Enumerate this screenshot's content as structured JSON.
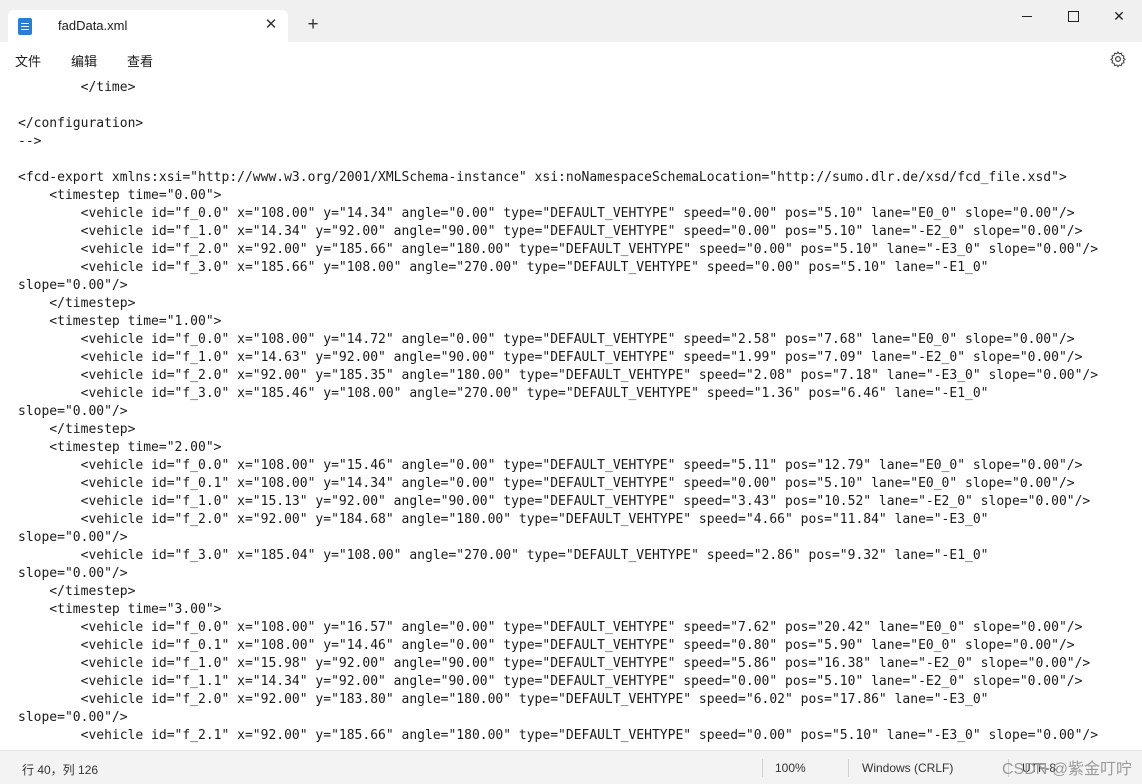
{
  "window": {
    "tab_title": "fadData.xml",
    "tab_close": "✕",
    "new_tab": "+",
    "minimize_label": "",
    "close_glyph": "✕"
  },
  "menu": {
    "items": [
      "文件",
      "编辑",
      "查看"
    ],
    "settings_icon": "gear-icon"
  },
  "editor": {
    "lines": [
      "        </time>",
      "",
      "</configuration>",
      "-->",
      "",
      "<fcd-export xmlns:xsi=\"http://www.w3.org/2001/XMLSchema-instance\" xsi:noNamespaceSchemaLocation=\"http://sumo.dlr.de/xsd/fcd_file.xsd\">",
      "    <timestep time=\"0.00\">",
      "        <vehicle id=\"f_0.0\" x=\"108.00\" y=\"14.34\" angle=\"0.00\" type=\"DEFAULT_VEHTYPE\" speed=\"0.00\" pos=\"5.10\" lane=\"E0_0\" slope=\"0.00\"/>",
      "        <vehicle id=\"f_1.0\" x=\"14.34\" y=\"92.00\" angle=\"90.00\" type=\"DEFAULT_VEHTYPE\" speed=\"0.00\" pos=\"5.10\" lane=\"-E2_0\" slope=\"0.00\"/>",
      "        <vehicle id=\"f_2.0\" x=\"92.00\" y=\"185.66\" angle=\"180.00\" type=\"DEFAULT_VEHTYPE\" speed=\"0.00\" pos=\"5.10\" lane=\"-E3_0\" slope=\"0.00\"/>",
      "        <vehicle id=\"f_3.0\" x=\"185.66\" y=\"108.00\" angle=\"270.00\" type=\"DEFAULT_VEHTYPE\" speed=\"0.00\" pos=\"5.10\" lane=\"-E1_0\"",
      "slope=\"0.00\"/>",
      "    </timestep>",
      "    <timestep time=\"1.00\">",
      "        <vehicle id=\"f_0.0\" x=\"108.00\" y=\"14.72\" angle=\"0.00\" type=\"DEFAULT_VEHTYPE\" speed=\"2.58\" pos=\"7.68\" lane=\"E0_0\" slope=\"0.00\"/>",
      "        <vehicle id=\"f_1.0\" x=\"14.63\" y=\"92.00\" angle=\"90.00\" type=\"DEFAULT_VEHTYPE\" speed=\"1.99\" pos=\"7.09\" lane=\"-E2_0\" slope=\"0.00\"/>",
      "        <vehicle id=\"f_2.0\" x=\"92.00\" y=\"185.35\" angle=\"180.00\" type=\"DEFAULT_VEHTYPE\" speed=\"2.08\" pos=\"7.18\" lane=\"-E3_0\" slope=\"0.00\"/>",
      "        <vehicle id=\"f_3.0\" x=\"185.46\" y=\"108.00\" angle=\"270.00\" type=\"DEFAULT_VEHTYPE\" speed=\"1.36\" pos=\"6.46\" lane=\"-E1_0\"",
      "slope=\"0.00\"/>",
      "    </timestep>",
      "    <timestep time=\"2.00\">",
      "        <vehicle id=\"f_0.0\" x=\"108.00\" y=\"15.46\" angle=\"0.00\" type=\"DEFAULT_VEHTYPE\" speed=\"5.11\" pos=\"12.79\" lane=\"E0_0\" slope=\"0.00\"/>",
      "        <vehicle id=\"f_0.1\" x=\"108.00\" y=\"14.34\" angle=\"0.00\" type=\"DEFAULT_VEHTYPE\" speed=\"0.00\" pos=\"5.10\" lane=\"E0_0\" slope=\"0.00\"/>",
      "        <vehicle id=\"f_1.0\" x=\"15.13\" y=\"92.00\" angle=\"90.00\" type=\"DEFAULT_VEHTYPE\" speed=\"3.43\" pos=\"10.52\" lane=\"-E2_0\" slope=\"0.00\"/>",
      "        <vehicle id=\"f_2.0\" x=\"92.00\" y=\"184.68\" angle=\"180.00\" type=\"DEFAULT_VEHTYPE\" speed=\"4.66\" pos=\"11.84\" lane=\"-E3_0\"",
      "slope=\"0.00\"/>",
      "        <vehicle id=\"f_3.0\" x=\"185.04\" y=\"108.00\" angle=\"270.00\" type=\"DEFAULT_VEHTYPE\" speed=\"2.86\" pos=\"9.32\" lane=\"-E1_0\"",
      "slope=\"0.00\"/>",
      "    </timestep>",
      "    <timestep time=\"3.00\">",
      "        <vehicle id=\"f_0.0\" x=\"108.00\" y=\"16.57\" angle=\"0.00\" type=\"DEFAULT_VEHTYPE\" speed=\"7.62\" pos=\"20.42\" lane=\"E0_0\" slope=\"0.00\"/>",
      "        <vehicle id=\"f_0.1\" x=\"108.00\" y=\"14.46\" angle=\"0.00\" type=\"DEFAULT_VEHTYPE\" speed=\"0.80\" pos=\"5.90\" lane=\"E0_0\" slope=\"0.00\"/>",
      "        <vehicle id=\"f_1.0\" x=\"15.98\" y=\"92.00\" angle=\"90.00\" type=\"DEFAULT_VEHTYPE\" speed=\"5.86\" pos=\"16.38\" lane=\"-E2_0\" slope=\"0.00\"/>",
      "        <vehicle id=\"f_1.1\" x=\"14.34\" y=\"92.00\" angle=\"90.00\" type=\"DEFAULT_VEHTYPE\" speed=\"0.00\" pos=\"5.10\" lane=\"-E2_0\" slope=\"0.00\"/>",
      "        <vehicle id=\"f_2.0\" x=\"92.00\" y=\"183.80\" angle=\"180.00\" type=\"DEFAULT_VEHTYPE\" speed=\"6.02\" pos=\"17.86\" lane=\"-E3_0\"",
      "slope=\"0.00\"/>",
      "        <vehicle id=\"f_2.1\" x=\"92.00\" y=\"185.66\" angle=\"180.00\" type=\"DEFAULT_VEHTYPE\" speed=\"0.00\" pos=\"5.10\" lane=\"-E3_0\" slope=\"0.00\"/>"
    ]
  },
  "status": {
    "position": "行 40，列 126",
    "zoom": "100%",
    "line_ending": "Windows (CRLF)",
    "encoding": "UTF-8",
    "watermark": "CSDN @紫金叮咛"
  }
}
